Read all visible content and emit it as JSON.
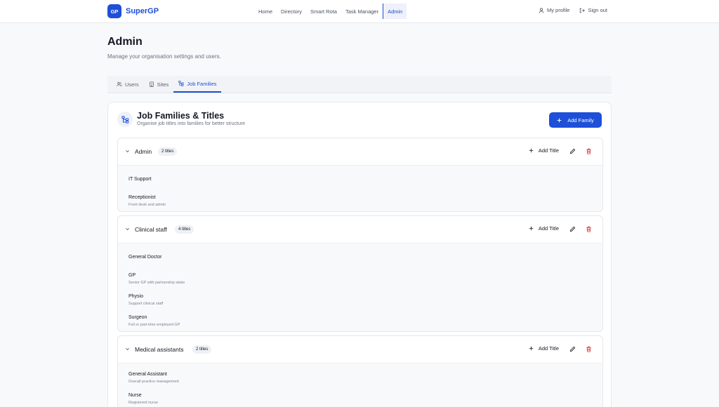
{
  "brand": {
    "logo_text": "GP",
    "name": "SuperGP"
  },
  "nav": [
    {
      "label": "Home"
    },
    {
      "label": "Directory"
    },
    {
      "label": "Smart Rota"
    },
    {
      "label": "Task Manager"
    },
    {
      "label": "Admin",
      "active": true
    }
  ],
  "user_menu": {
    "profile_label": "My profile",
    "profile_icon": "user-icon",
    "signout_label": "Sign out",
    "signout_icon": "logout-icon"
  },
  "page": {
    "title": "Admin",
    "subtitle": "Manage your organisation settings and users."
  },
  "tabs": [
    {
      "label": "Users",
      "icon": "users-icon"
    },
    {
      "label": "Sites",
      "icon": "building-icon"
    },
    {
      "label": "Job Families",
      "icon": "hierarchy-icon",
      "active": true
    }
  ],
  "card": {
    "title": "Job Families & Titles",
    "subtitle": "Organise job titles into families for better structure",
    "add_family_label": "Add Family"
  },
  "families": [
    {
      "name": "Admin",
      "badge": "2 titles",
      "add_title_label": "Add Title",
      "titles": [
        {
          "name": "IT Support",
          "description": ""
        },
        {
          "name": "Receptionist",
          "description": "Front desk and admin"
        }
      ]
    },
    {
      "name": "Clinical staff",
      "badge": "4 titles",
      "add_title_label": "Add Title",
      "titles": [
        {
          "name": "General Doctor",
          "description": ""
        },
        {
          "name": "GP",
          "description": "Senior GP with partnership stake"
        },
        {
          "name": "Physio",
          "description": "Support clinical staff"
        },
        {
          "name": "Surgeon",
          "description": "Full or part-time employed GP"
        }
      ]
    },
    {
      "name": "Medical assistants",
      "badge": "2 titles",
      "add_title_label": "Add Title",
      "titles": [
        {
          "name": "General Assistant",
          "description": "Overall practice management"
        },
        {
          "name": "Nurse",
          "description": "Registered nurse"
        }
      ]
    }
  ],
  "colors": {
    "accent": "#1d4fd8",
    "danger": "#dc2626",
    "background": "#f8f9fb"
  }
}
